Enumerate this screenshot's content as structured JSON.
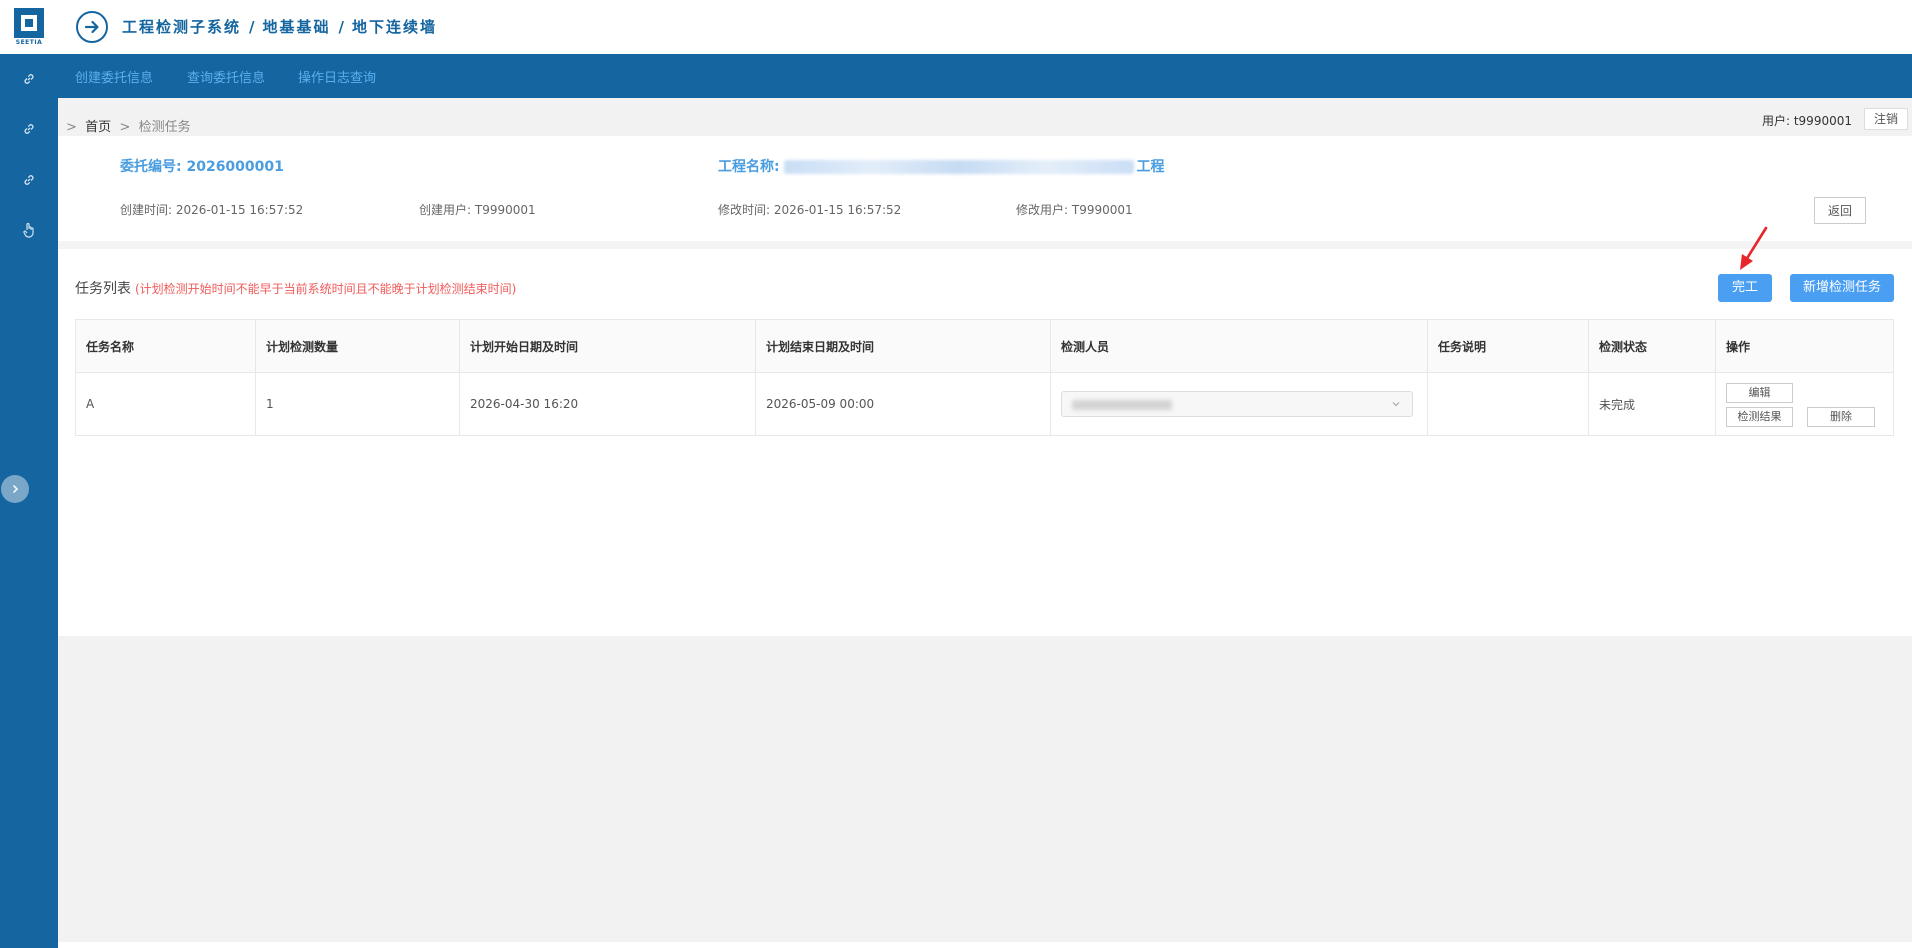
{
  "app": {
    "logo_text": "SEETIA",
    "breadcrumb_title": [
      "工程检测子系统",
      "地基基础",
      "地下连续墙"
    ],
    "title_separator": "/"
  },
  "nav": {
    "items": [
      {
        "label": "创建委托信息"
      },
      {
        "label": "查询委托信息"
      },
      {
        "label": "操作日志查询"
      }
    ]
  },
  "crumbbar": {
    "prefix": ">",
    "home": "首页",
    "sep": ">",
    "current": "检测任务",
    "user_label": "用户: t9990001",
    "logout": "注销"
  },
  "commission": {
    "number_label": "委托编号: 2026000001",
    "project_label": "工程名称:",
    "project_suffix": "工程",
    "created_time": "创建时间: 2026-01-15 16:57:52",
    "created_user": "创建用户: T9990001",
    "modified_time": "修改时间: 2026-01-15 16:57:52",
    "modified_user": "修改用户: T9990001",
    "return_button": "返回"
  },
  "tasklist": {
    "title": "任务列表",
    "warning": "(计划检测开始时间不能早于当前系统时间且不能晚于计划检测结束时间)",
    "complete_button": "完工",
    "add_button": "新增检测任务",
    "columns": [
      "任务名称",
      "计划检测数量",
      "计划开始日期及时间",
      "计划结束日期及时间",
      "检测人员",
      "任务说明",
      "检测状态",
      "操作"
    ],
    "rows": [
      {
        "name": "A",
        "quantity": "1",
        "start": "2026-04-30 16:20",
        "end": "2026-05-09 00:00",
        "inspector": "",
        "description": "",
        "status": "未完成",
        "actions": {
          "edit": "编辑",
          "result": "检测结果",
          "delete": "删除"
        }
      }
    ]
  },
  "colors": {
    "brand": "#1565a0",
    "link": "#5ab0ee",
    "label": "#4a9de0",
    "primary_button": "#4a9ff3",
    "warning": "#f05b5b",
    "annotation_arrow": "#e8252a"
  }
}
